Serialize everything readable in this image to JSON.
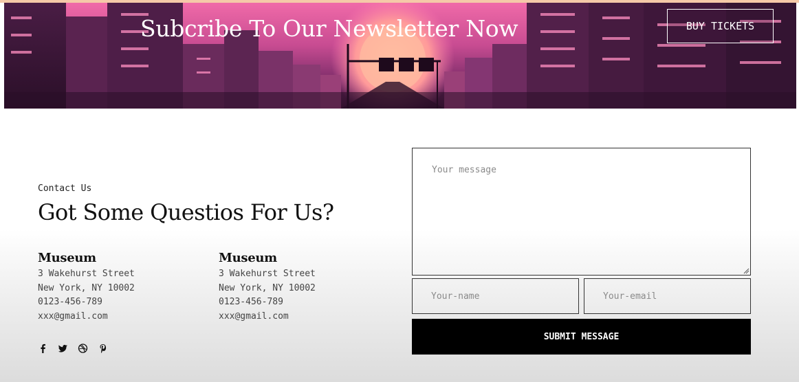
{
  "banner": {
    "title": "Subcribe To Our Newsletter Now",
    "button_label": "BUY TICKETS"
  },
  "contact": {
    "eyebrow": "Contact Us",
    "heading": "Got Some Questios For Us?",
    "locations": [
      {
        "name": "Museum",
        "street": "3 Wakehurst Street",
        "city": "New York, NY 10002",
        "phone": "0123-456-789",
        "email": "xxx@gmail.com"
      },
      {
        "name": "Museum",
        "street": "3 Wakehurst Street",
        "city": "New York, NY 10002",
        "phone": "0123-456-789",
        "email": "xxx@gmail.com"
      }
    ],
    "social_icons": [
      "facebook-icon",
      "twitter-icon",
      "dribbble-icon",
      "pinterest-icon"
    ]
  },
  "form": {
    "message_placeholder": "Your message",
    "name_placeholder": "Your-name",
    "email_placeholder": "Your-email",
    "submit_label": "SUBMIT MESSAGE"
  },
  "colors": {
    "accent_top": "#f5c9a8",
    "submit_bg": "#000000",
    "banner_pink": "#f06aa8"
  }
}
